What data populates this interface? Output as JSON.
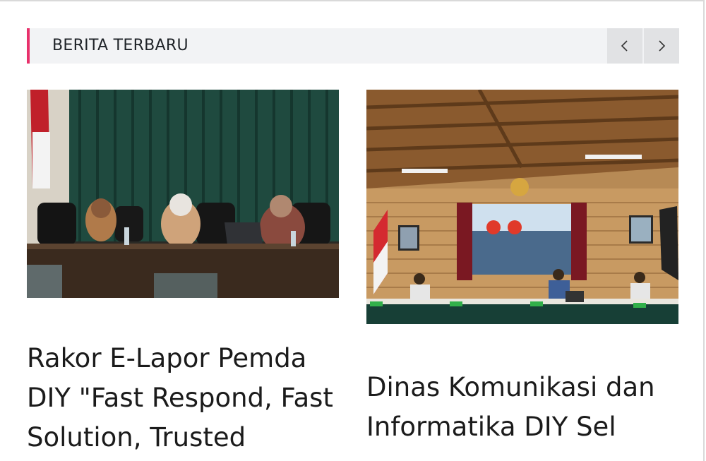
{
  "section": {
    "title": "BERITA TERBARU",
    "accent_color": "#e8316b",
    "prev_icon": "chevron-left-icon",
    "next_icon": "chevron-right-icon"
  },
  "cards": [
    {
      "image_alt": "Meeting room with three people seated behind a table with a green curtain",
      "title": "Rakor E-Lapor Pemda DIY \"Fast Respond, Fast Solution, Trusted"
    },
    {
      "image_alt": "Hall with wooden ceiling and a presentation screen, speakers at a long table",
      "title": "Dinas Komunikasi dan Informatika DIY Sel"
    }
  ]
}
